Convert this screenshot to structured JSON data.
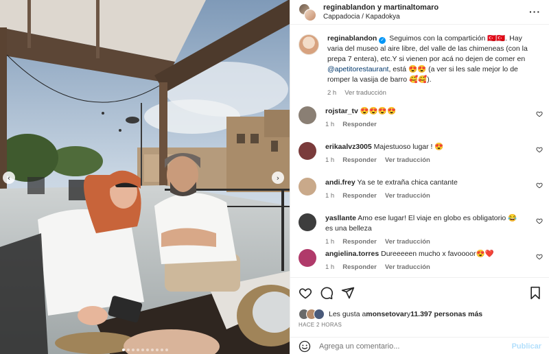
{
  "post": {
    "header": {
      "users": "reginablandon y martinaltomaro",
      "location": "Cappadocia / Kapadokya",
      "more_icon": "more-horizontal-icon"
    },
    "caption": {
      "username": "reginablandon",
      "text_part1": "Seguimos con la compartición ",
      "emoji1": "🇹🇷🇹🇷",
      "text_part2": ". Hay varia del museo al aire libre, del valle de las chimeneas (con la prepa 7 entera), etc.Y si vienen por acá no dejen de comer en ",
      "mention": "@apetitorestaurant",
      "text_part3": ", está ",
      "emoji2": "😍😍",
      "text_part4": " (a ver si les sale mejor lo de romper la vasija de barro ",
      "emoji3": "🥰🥰",
      "text_part5": ").",
      "time": "2 h",
      "translate": "Ver traducción"
    },
    "comments": [
      {
        "username": "rojstar_tv",
        "text": "😍😍😍😍",
        "time": "1 h",
        "reply": "Responder",
        "translate": "",
        "avatar_color": "#8a7f74"
      },
      {
        "username": "erikaalvz3005",
        "text": "Majestuoso lugar ! 😍",
        "time": "1 h",
        "reply": "Responder",
        "translate": "Ver traducción",
        "avatar_color": "#7a3b3b"
      },
      {
        "username": "andi.frey",
        "text": "Ya se te extraña chica cantante",
        "time": "1 h",
        "reply": "Responder",
        "translate": "Ver traducción",
        "avatar_color": "#c9a98a"
      },
      {
        "username": "yasllante",
        "text": "Amo ese lugar! El viaje en globo es obligatorio 😂 es una belleza",
        "time": "1 h",
        "reply": "Responder",
        "translate": "Ver traducción",
        "avatar_color": "#3d3d3d"
      },
      {
        "username": "angielina.torres",
        "text": "Dureeeeen mucho x favoooor😍❤️",
        "time": "1 h",
        "reply": "Responder",
        "translate": "Ver traducción",
        "avatar_color": "#b03a6a"
      }
    ],
    "likes": {
      "prefix": "Les gusta a ",
      "user": "monsetovar",
      "middle": " y ",
      "count": "11.397 personas más"
    },
    "timestamp": "HACE 2 HORAS",
    "add_comment": {
      "placeholder": "Agrega un comentario...",
      "publish": "Publicar"
    },
    "carousel": {
      "total": 10,
      "active": 1
    }
  }
}
